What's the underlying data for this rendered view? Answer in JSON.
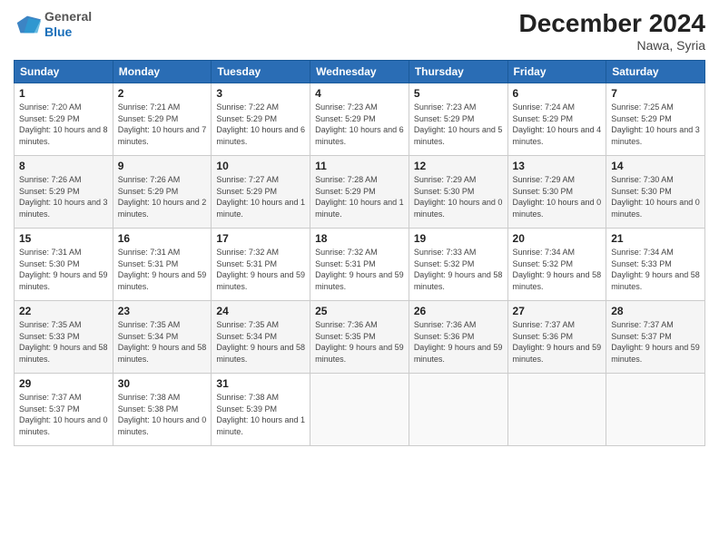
{
  "header": {
    "logo_general": "General",
    "logo_blue": "Blue",
    "month_title": "December 2024",
    "location": "Nawa, Syria"
  },
  "days_of_week": [
    "Sunday",
    "Monday",
    "Tuesday",
    "Wednesday",
    "Thursday",
    "Friday",
    "Saturday"
  ],
  "weeks": [
    [
      {
        "day": "1",
        "sunrise": "7:20 AM",
        "sunset": "5:29 PM",
        "daylight": "10 hours and 8 minutes."
      },
      {
        "day": "2",
        "sunrise": "7:21 AM",
        "sunset": "5:29 PM",
        "daylight": "10 hours and 7 minutes."
      },
      {
        "day": "3",
        "sunrise": "7:22 AM",
        "sunset": "5:29 PM",
        "daylight": "10 hours and 6 minutes."
      },
      {
        "day": "4",
        "sunrise": "7:23 AM",
        "sunset": "5:29 PM",
        "daylight": "10 hours and 6 minutes."
      },
      {
        "day": "5",
        "sunrise": "7:23 AM",
        "sunset": "5:29 PM",
        "daylight": "10 hours and 5 minutes."
      },
      {
        "day": "6",
        "sunrise": "7:24 AM",
        "sunset": "5:29 PM",
        "daylight": "10 hours and 4 minutes."
      },
      {
        "day": "7",
        "sunrise": "7:25 AM",
        "sunset": "5:29 PM",
        "daylight": "10 hours and 3 minutes."
      }
    ],
    [
      {
        "day": "8",
        "sunrise": "7:26 AM",
        "sunset": "5:29 PM",
        "daylight": "10 hours and 3 minutes."
      },
      {
        "day": "9",
        "sunrise": "7:26 AM",
        "sunset": "5:29 PM",
        "daylight": "10 hours and 2 minutes."
      },
      {
        "day": "10",
        "sunrise": "7:27 AM",
        "sunset": "5:29 PM",
        "daylight": "10 hours and 1 minute."
      },
      {
        "day": "11",
        "sunrise": "7:28 AM",
        "sunset": "5:29 PM",
        "daylight": "10 hours and 1 minute."
      },
      {
        "day": "12",
        "sunrise": "7:29 AM",
        "sunset": "5:30 PM",
        "daylight": "10 hours and 0 minutes."
      },
      {
        "day": "13",
        "sunrise": "7:29 AM",
        "sunset": "5:30 PM",
        "daylight": "10 hours and 0 minutes."
      },
      {
        "day": "14",
        "sunrise": "7:30 AM",
        "sunset": "5:30 PM",
        "daylight": "10 hours and 0 minutes."
      }
    ],
    [
      {
        "day": "15",
        "sunrise": "7:31 AM",
        "sunset": "5:30 PM",
        "daylight": "9 hours and 59 minutes."
      },
      {
        "day": "16",
        "sunrise": "7:31 AM",
        "sunset": "5:31 PM",
        "daylight": "9 hours and 59 minutes."
      },
      {
        "day": "17",
        "sunrise": "7:32 AM",
        "sunset": "5:31 PM",
        "daylight": "9 hours and 59 minutes."
      },
      {
        "day": "18",
        "sunrise": "7:32 AM",
        "sunset": "5:31 PM",
        "daylight": "9 hours and 59 minutes."
      },
      {
        "day": "19",
        "sunrise": "7:33 AM",
        "sunset": "5:32 PM",
        "daylight": "9 hours and 58 minutes."
      },
      {
        "day": "20",
        "sunrise": "7:34 AM",
        "sunset": "5:32 PM",
        "daylight": "9 hours and 58 minutes."
      },
      {
        "day": "21",
        "sunrise": "7:34 AM",
        "sunset": "5:33 PM",
        "daylight": "9 hours and 58 minutes."
      }
    ],
    [
      {
        "day": "22",
        "sunrise": "7:35 AM",
        "sunset": "5:33 PM",
        "daylight": "9 hours and 58 minutes."
      },
      {
        "day": "23",
        "sunrise": "7:35 AM",
        "sunset": "5:34 PM",
        "daylight": "9 hours and 58 minutes."
      },
      {
        "day": "24",
        "sunrise": "7:35 AM",
        "sunset": "5:34 PM",
        "daylight": "9 hours and 58 minutes."
      },
      {
        "day": "25",
        "sunrise": "7:36 AM",
        "sunset": "5:35 PM",
        "daylight": "9 hours and 59 minutes."
      },
      {
        "day": "26",
        "sunrise": "7:36 AM",
        "sunset": "5:36 PM",
        "daylight": "9 hours and 59 minutes."
      },
      {
        "day": "27",
        "sunrise": "7:37 AM",
        "sunset": "5:36 PM",
        "daylight": "9 hours and 59 minutes."
      },
      {
        "day": "28",
        "sunrise": "7:37 AM",
        "sunset": "5:37 PM",
        "daylight": "9 hours and 59 minutes."
      }
    ],
    [
      {
        "day": "29",
        "sunrise": "7:37 AM",
        "sunset": "5:37 PM",
        "daylight": "10 hours and 0 minutes."
      },
      {
        "day": "30",
        "sunrise": "7:38 AM",
        "sunset": "5:38 PM",
        "daylight": "10 hours and 0 minutes."
      },
      {
        "day": "31",
        "sunrise": "7:38 AM",
        "sunset": "5:39 PM",
        "daylight": "10 hours and 1 minute."
      },
      null,
      null,
      null,
      null
    ]
  ]
}
